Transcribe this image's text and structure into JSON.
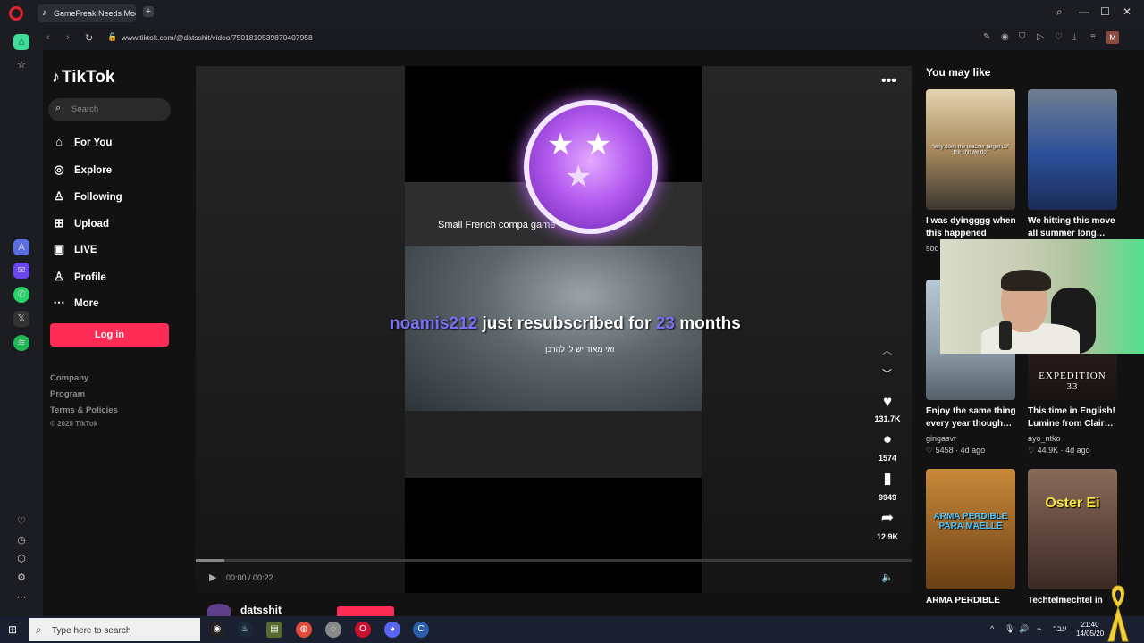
{
  "browser": {
    "tab_title": "GameFreak Needs Moder",
    "tab_icon": "tiktok-icon",
    "url": "www.tiktok.com/@datsshit/video/7501810539870407958",
    "profile_initial": "M"
  },
  "tiktok": {
    "logo": "TikTok",
    "search_placeholder": "Search",
    "nav": [
      {
        "label": "For You",
        "icon": "home-icon"
      },
      {
        "label": "Explore",
        "icon": "compass-icon"
      },
      {
        "label": "Following",
        "icon": "following-icon"
      },
      {
        "label": "Upload",
        "icon": "upload-icon"
      },
      {
        "label": "LIVE",
        "icon": "live-icon"
      },
      {
        "label": "Profile",
        "icon": "person-icon"
      },
      {
        "label": "More",
        "icon": "more-icon"
      }
    ],
    "login_label": "Log in",
    "footer_links": [
      "Company",
      "Program",
      "Terms & Policies"
    ],
    "copyright": "© 2025 TikTok"
  },
  "video": {
    "caption": "Small French compa          game",
    "hebrew_subtitle": "ואי מאוד יש לי להרכן",
    "overlay_user": "noamis212",
    "overlay_text": "just resubscribed for",
    "overlay_number": "23",
    "overlay_suffix": "months",
    "time": "00:00 / 00:22",
    "progress": 0.04,
    "author": "datsshit",
    "likes": "131.7K",
    "comments": "1574",
    "saves": "9949",
    "shares": "12.9K"
  },
  "recommendations": {
    "heading": "You may like",
    "cards": [
      {
        "title": "I was dyingggg when this happened",
        "author": "soo",
        "thumb_caption": "\"why does the teacher target us\" the shit we do:",
        "thumb_color": "#6b6152"
      },
      {
        "title": "We hitting this move all summer long…",
        "author": "",
        "thumb_caption": "",
        "thumb_color": "#1f3f8a"
      },
      {
        "title": "Enjoy the same thing every year though…",
        "author": "gingasvr",
        "likes": "5458",
        "age": "4d ago",
        "thumb_caption": "",
        "thumb_color": "#8aa3b5"
      },
      {
        "title": "This time in English! Lumine from Clair…",
        "author": "ayo_ntko",
        "likes": "44.9K",
        "age": "4d ago",
        "thumb_caption": "EXPEDITION 33",
        "thumb_color": "#3a1c1c"
      },
      {
        "title": "ARMA PERDIBLE",
        "author": "",
        "thumb_caption": "ARMA PERDIBLE PARA MAELLE",
        "thumb_color": "#7a4a1a"
      },
      {
        "title": "Techtelmechtel in",
        "author": "",
        "thumb_caption": "Oster Ei",
        "thumb_color": "#5a3a2a"
      }
    ]
  },
  "taskbar": {
    "search_placeholder": "Type here to search",
    "lang": "עבר",
    "time": "21:40",
    "date": "14/05/20"
  }
}
